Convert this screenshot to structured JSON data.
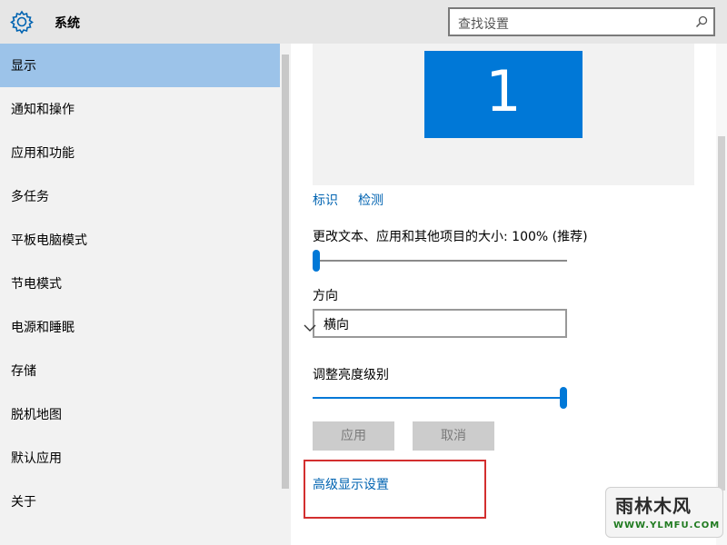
{
  "header": {
    "title": "系统",
    "icon": "gear-icon",
    "search_placeholder": "查找设置",
    "search_icon": "search-icon"
  },
  "sidebar": {
    "items": [
      {
        "label": "显示",
        "active": true
      },
      {
        "label": "通知和操作"
      },
      {
        "label": "应用和功能"
      },
      {
        "label": "多任务"
      },
      {
        "label": "平板电脑模式"
      },
      {
        "label": "节电模式"
      },
      {
        "label": "电源和睡眠"
      },
      {
        "label": "存储"
      },
      {
        "label": "脱机地图"
      },
      {
        "label": "默认应用"
      },
      {
        "label": "关于"
      }
    ]
  },
  "main": {
    "monitor_number": "1",
    "identify_link": "标识",
    "detect_link": "检测",
    "scale_label": "更改文本、应用和其他项目的大小: 100% (推荐)",
    "scale_level": 0,
    "orientation_label": "方向",
    "orientation_value": "横向",
    "brightness_label": "调整亮度级别",
    "brightness_level": 1,
    "apply_button": "应用",
    "cancel_button": "取消",
    "advanced_link": "高级显示设置"
  },
  "watermark": {
    "name": "雨林木风",
    "url": "WWW.YLMFU.COM"
  },
  "colors": {
    "accent": "#0078d7",
    "active_nav": "#9cc3e9",
    "link": "#0063b1",
    "highlight": "#d32f2f"
  }
}
